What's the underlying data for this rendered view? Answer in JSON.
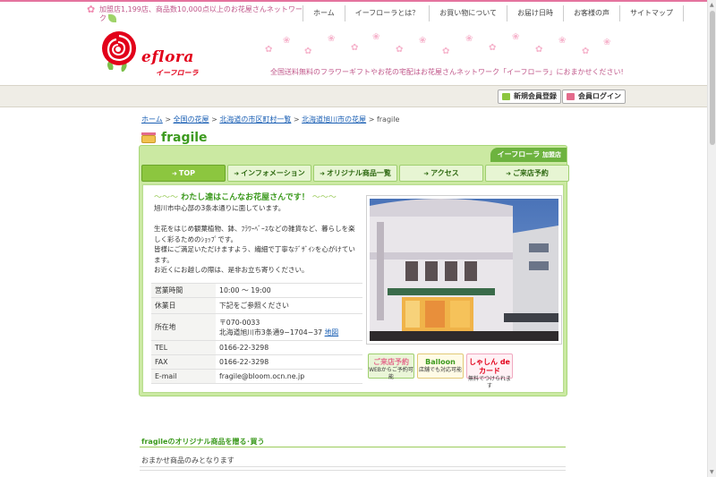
{
  "header": {
    "tagline": "加盟店1,199店、商品数10,000点以上のお花屋さんネットワーク",
    "nav": [
      "ホーム",
      "イーフローラとは？",
      "お買い物について",
      "お届け日時",
      "お客様の声",
      "サイトマップ"
    ],
    "logo_text": "eflora",
    "logo_sub": "イーフローラ",
    "message": "全国送料無料のフラワーギフトやお花の宅配はお花屋さんネットワーク「イーフローラ」におまかせください!"
  },
  "member": {
    "register_label": "新規会員登録",
    "login_label": "会員ログイン"
  },
  "breadcrumb": {
    "items": [
      "ホーム",
      "全国の花屋",
      "北海道の市区町村一覧",
      "北海道旭川市の花屋"
    ],
    "sep": ">",
    "current": "fragile"
  },
  "shop": {
    "name": "fragile",
    "brand_tab": "イーフローラ",
    "brand_tab_small": "加盟店",
    "tabs": [
      "TOP",
      "インフォメーション",
      "オリジナル商品一覧",
      "アクセス",
      "ご来店予約"
    ],
    "tab_arrow": "➜",
    "heading": "わたし達はこんなお花屋さんです！",
    "heading_deco_left": "～～～",
    "heading_deco_right": "～～～",
    "intro": "旭川市中心部の3条本通りに面しています。\n\n生花をはじめ観葉植物、鉢、ﾌﾗﾜｰﾍﾞｰｽなどの雑貨など、暮らしを楽しく彩るためのｼｮｯﾌﾟです。\n皆様にご満足いただけますよう、繊細で丁寧なﾃﾞｻﾞｲﾝを心がけています。\nお近くにお越しの際は、是非お立ち寄りください。",
    "info": {
      "hours_label": "営業時間",
      "hours": "10:00 ～ 19:00",
      "closed_label": "休業日",
      "closed": "下記をご参照ください",
      "address_label": "所在地",
      "zip": "〒070-0033",
      "address": "北海道旭川市3条通9−1704−37",
      "map_link": "地図",
      "tel_label": "TEL",
      "tel": "0166-22-3298",
      "fax_label": "FAX",
      "fax": "0166-22-3298",
      "email_label": "E-mail",
      "email": "fragile@bloom.ocn.ne.jp"
    },
    "banners": [
      {
        "title": "ご来店予約",
        "sub": "WEBからご予約可能"
      },
      {
        "title": "Balloon",
        "sub": "店舗でも対応可能"
      },
      {
        "title": "しゃしん de カード",
        "sub": "無料でつけられます"
      }
    ]
  },
  "section": {
    "title": "fragileのオリジナル商品を贈る･買う",
    "text": "おまかせ商品のみとなります"
  },
  "colors": {
    "accent_green": "#8cc63f",
    "brand_red": "#e2001a",
    "pink": "#c0578a"
  }
}
